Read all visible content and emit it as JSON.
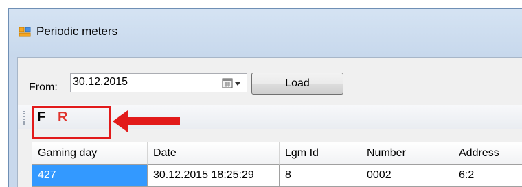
{
  "window": {
    "title": "Periodic meters",
    "icon": "app-window-icon"
  },
  "filter": {
    "from_label": "From:",
    "date_value": "30.12.2015",
    "calendar_icon": "calendar-dropdown-icon",
    "load_label": "Load"
  },
  "toolbar": {
    "f_label": "F",
    "r_label": "R",
    "r_color": "#e0332c"
  },
  "annotation": {
    "highlight_color": "#e21a1a",
    "arrow_icon": "left-arrow-icon"
  },
  "grid": {
    "columns": [
      "Gaming day",
      "Date",
      "Lgm Id",
      "Number",
      "Address"
    ],
    "rows": [
      [
        "427",
        "30.12.2015 18:25:29",
        "8",
        "0002",
        "6:2"
      ]
    ],
    "selection_color": "#3399ff"
  }
}
